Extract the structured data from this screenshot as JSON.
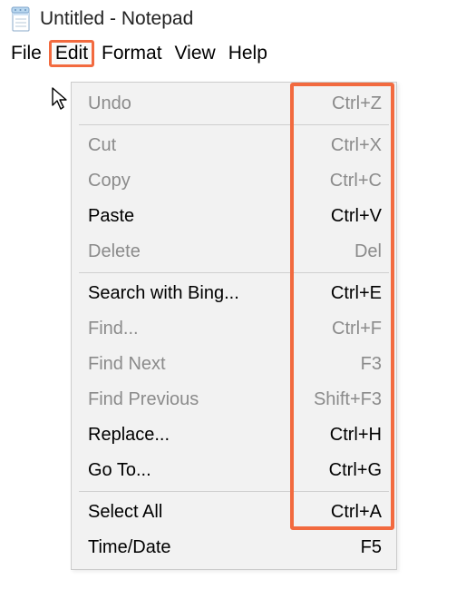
{
  "title": "Untitled - Notepad",
  "menubar": {
    "file": "File",
    "edit": "Edit",
    "format": "Format",
    "view": "View",
    "help": "Help"
  },
  "editMenu": {
    "undo": {
      "label": "Undo",
      "shortcut": "Ctrl+Z",
      "enabled": false
    },
    "cut": {
      "label": "Cut",
      "shortcut": "Ctrl+X",
      "enabled": false
    },
    "copy": {
      "label": "Copy",
      "shortcut": "Ctrl+C",
      "enabled": false
    },
    "paste": {
      "label": "Paste",
      "shortcut": "Ctrl+V",
      "enabled": true
    },
    "delete": {
      "label": "Delete",
      "shortcut": "Del",
      "enabled": false
    },
    "searchBing": {
      "label": "Search with Bing...",
      "shortcut": "Ctrl+E",
      "enabled": true
    },
    "find": {
      "label": "Find...",
      "shortcut": "Ctrl+F",
      "enabled": false
    },
    "findNext": {
      "label": "Find Next",
      "shortcut": "F3",
      "enabled": false
    },
    "findPrevious": {
      "label": "Find Previous",
      "shortcut": "Shift+F3",
      "enabled": false
    },
    "replace": {
      "label": "Replace...",
      "shortcut": "Ctrl+H",
      "enabled": true
    },
    "goTo": {
      "label": "Go To...",
      "shortcut": "Ctrl+G",
      "enabled": true
    },
    "selectAll": {
      "label": "Select All",
      "shortcut": "Ctrl+A",
      "enabled": true
    },
    "timeDate": {
      "label": "Time/Date",
      "shortcut": "F5",
      "enabled": true
    }
  },
  "highlightColor": "#f26a3f"
}
